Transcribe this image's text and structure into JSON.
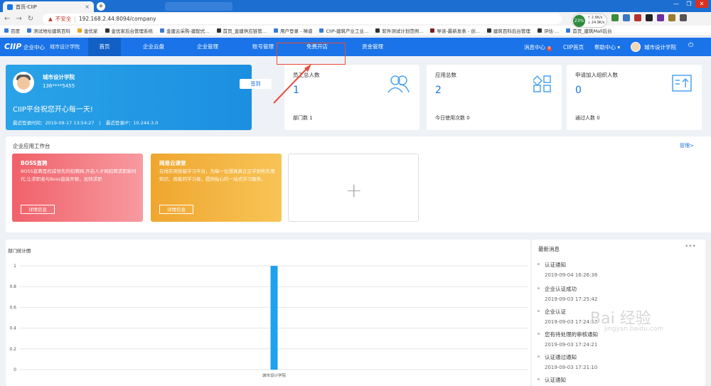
{
  "browser": {
    "tab_title": "首页-CIIP",
    "tab_close": "×",
    "new_tab": "+",
    "win_controls": [
      "—",
      "❐",
      "✕"
    ],
    "warning_icon": "▲",
    "insecure_label": "不安全",
    "url": "192.168.2.44:8094/company",
    "speed_percent": "23%",
    "speed_up": "↑ 2.9K/s",
    "speed_down": "↓ 24.9K/s"
  },
  "bookmarks": [
    {
      "label": "百度"
    },
    {
      "label": "测试地址建筑百科"
    },
    {
      "label": "金优家"
    },
    {
      "label": "金优家后台管理系统"
    },
    {
      "label": "金建云采购-建配式..."
    },
    {
      "label": "首页_金建供应链管..."
    },
    {
      "label": "用户登录 - 禅道"
    },
    {
      "label": "CIIP-建筑产业工业..."
    },
    {
      "label": "软件测试计划范例..."
    },
    {
      "label": "导读-最新发表 - 创..."
    },
    {
      "label": "建筑百科后台管理"
    },
    {
      "label": "评估·..."
    },
    {
      "label": "首页_建筑Mall后台"
    }
  ],
  "appnav": {
    "logo": "CIIP",
    "enterprise_center": "企业中心",
    "enterprise_name": "城市设计学院",
    "items": [
      {
        "label": "首页",
        "active": true
      },
      {
        "label": "企业云盘",
        "active": false
      },
      {
        "label": "企业管理",
        "active": false
      },
      {
        "label": "账号管理",
        "active": false
      },
      {
        "label": "免费开店",
        "active": false
      },
      {
        "label": "资金管理",
        "active": false
      }
    ],
    "messages": "消息中心",
    "messages_count": "8",
    "ciip_home": "CIIP首页",
    "help": "帮助中心 ▾",
    "user_name": "城市设计学院",
    "power": "⏻"
  },
  "profile": {
    "name": "城市设计学院",
    "phone": "136****5455",
    "sign_in": "签到",
    "greeting": "CIIP平台祝您开心每一天!",
    "last_login_time": "最近登录时间：2019-09-17 13:54:27",
    "separator": "|",
    "last_login_ip": "最近登录IP：10.244.3.0"
  },
  "stats": [
    {
      "label": "员工总人数",
      "value": "1",
      "sub": "部门数   1"
    },
    {
      "label": "应用总数",
      "value": "2",
      "sub": "今日使用次数   0"
    },
    {
      "label": "申请加入组织人数",
      "value": "0",
      "sub": "通过人数   0"
    }
  ],
  "workbench": {
    "title": "企业应用工作台",
    "manage": "管理>",
    "apps": [
      {
        "title": "BOSS直聘",
        "desc": "BOSS直聘是权威领先的招聘网,开启人才网招聘求职新时代,让求职者与Boss直接开聊，加快求职",
        "button": "详情信息",
        "color": "#f2747a"
      },
      {
        "title": "网易云课堂",
        "desc": "在线实用技能学习平台，为每一位想真真正正学到些实用知识、技能的学习者，提供贴心的一站式学习服务。",
        "button": "详情信息",
        "color": "#f2b63e"
      }
    ]
  },
  "dept_chart": {
    "title": "部门统计图"
  },
  "chart_data": {
    "type": "bar",
    "categories": [
      "城市设计学院"
    ],
    "values": [
      1
    ],
    "ylim": [
      0,
      1
    ],
    "yticks": [
      "0",
      "0.2",
      "0.4",
      "0.6",
      "0.8",
      "1"
    ],
    "grid": true,
    "color": "#1ea1ee"
  },
  "messages_panel": {
    "title": "最新消息",
    "more": "•••",
    "items": [
      {
        "title": "认证通知",
        "date": "2019-09-04 16:26:38"
      },
      {
        "title": "企业认证成功",
        "date": "2019-09-03 17:25:42"
      },
      {
        "title": "企业认证",
        "date": "2019-09-03 17:24:57"
      },
      {
        "title": "您有待处理的审核通知",
        "date": "2019-09-03 17:24:21"
      },
      {
        "title": "认证通过通知",
        "date": "2019-09-03 17:21:10"
      },
      {
        "title": "认证通知",
        "date": ""
      }
    ]
  },
  "watermark": {
    "text": "Bai 经验",
    "sub": "jingyan.baidu.com"
  }
}
